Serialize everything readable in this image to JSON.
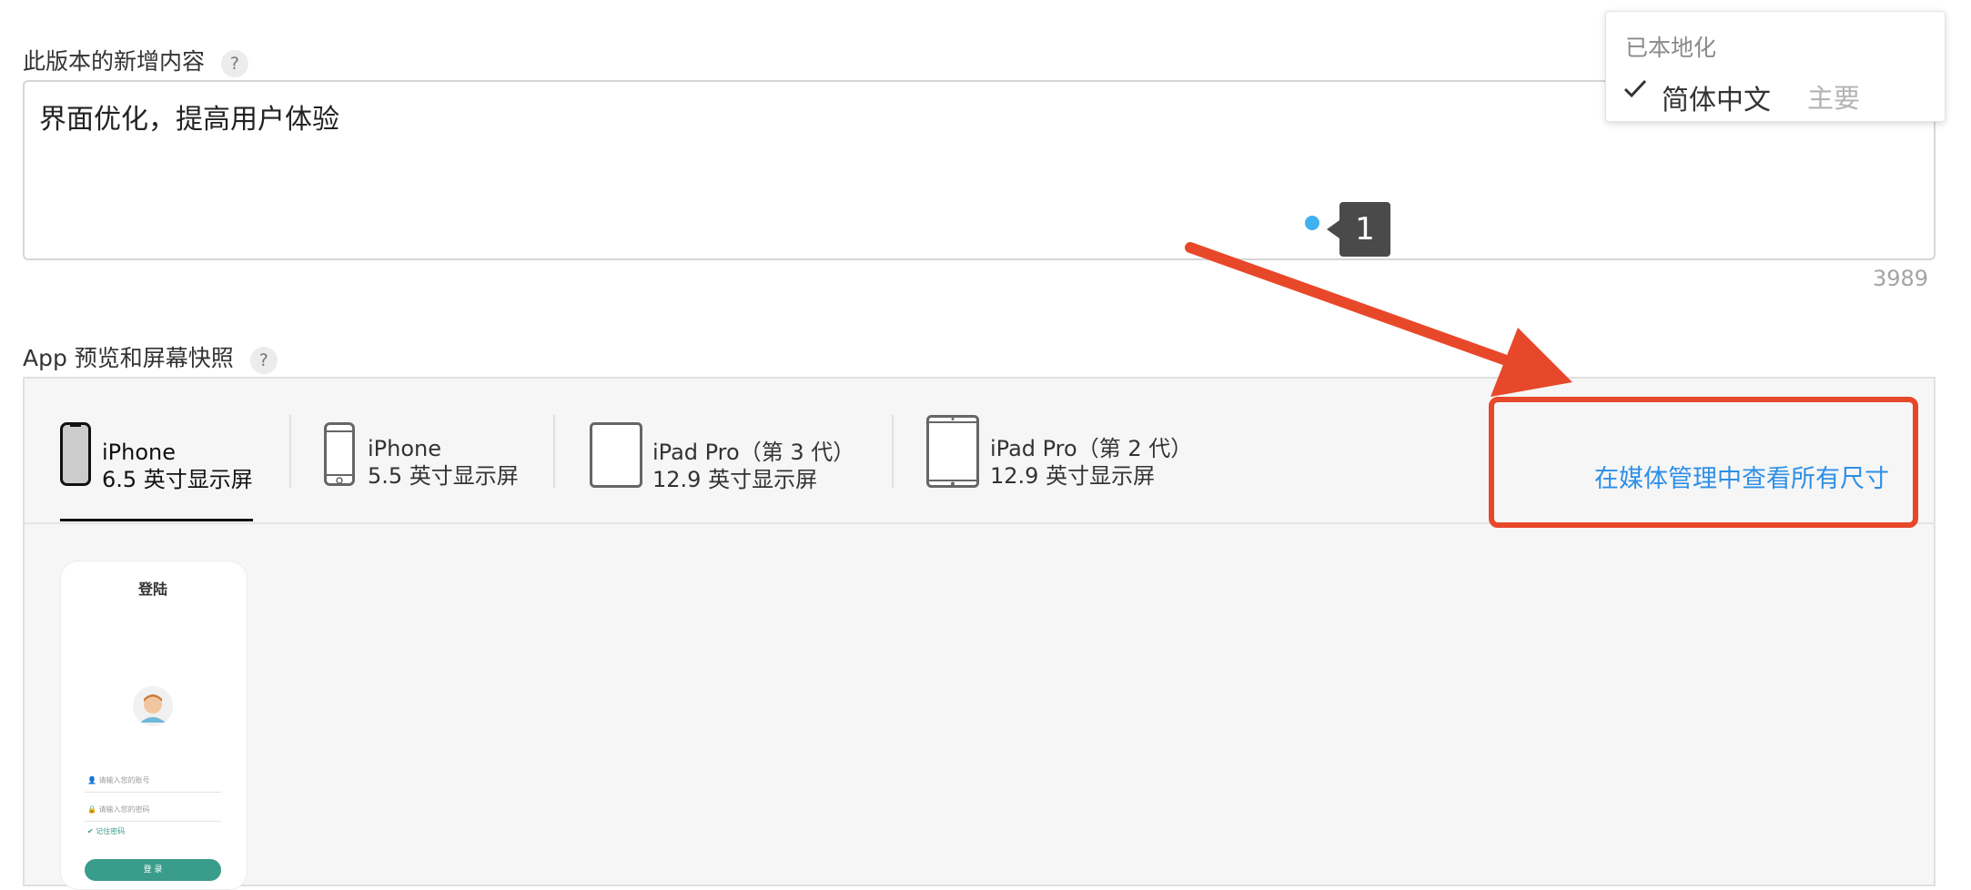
{
  "whats_new": {
    "label": "此版本的新增内容",
    "help": "?",
    "text": "界面优化，提高用户体验",
    "char_count": "3989"
  },
  "tooltip": {
    "number": "1"
  },
  "localization_dropdown": {
    "title": "已本地化",
    "item_label": "简体中文",
    "item_tag": "主要",
    "check_icon": "checkmark-icon"
  },
  "preview": {
    "label": "App 预览和屏幕快照",
    "help": "?",
    "tabs": [
      {
        "title": "iPhone",
        "subtitle": "6.5 英寸显示屏",
        "icon": "iphone-65-icon"
      },
      {
        "title": "iPhone",
        "subtitle": "5.5 英寸显示屏",
        "icon": "iphone-55-icon"
      },
      {
        "title": "iPad Pro（第 3 代）",
        "subtitle": "12.9 英寸显示屏",
        "icon": "ipad-pro-3-icon"
      },
      {
        "title": "iPad Pro（第 2 代）",
        "subtitle": "12.9 英寸显示屏",
        "icon": "ipad-pro-2-icon"
      }
    ],
    "view_all_link": "在媒体管理中查看所有尺寸"
  },
  "screenshot": {
    "title": "登陆",
    "account_placeholder": "请输入您的账号",
    "password_placeholder": "请输入您的密码",
    "remember": "记住密码",
    "button": "登 录"
  },
  "colors": {
    "accent_link": "#2e8fe6",
    "annotation_red": "#e8482a",
    "tooltip_dot": "#3fb1ef"
  }
}
